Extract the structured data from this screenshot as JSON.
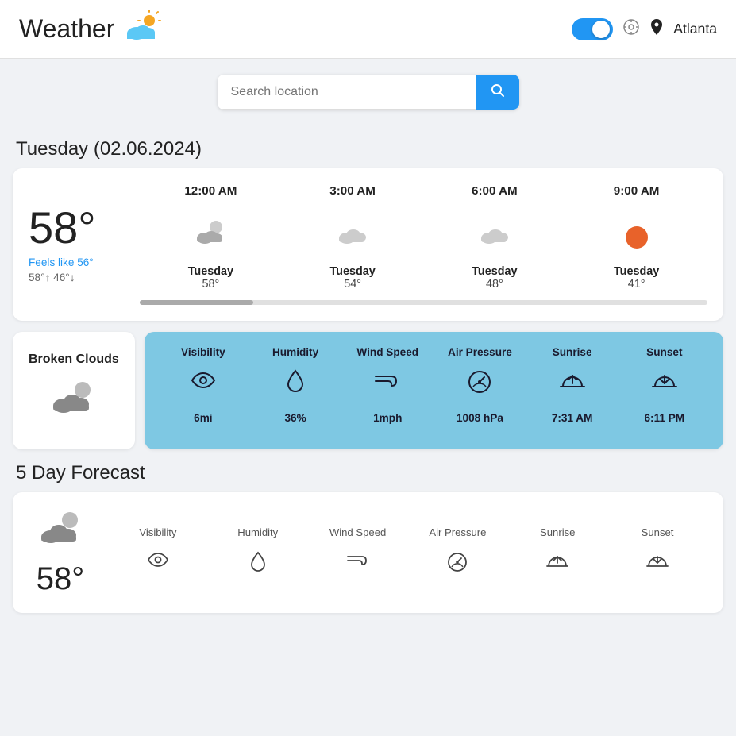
{
  "header": {
    "title": "Weather",
    "location": "Atlanta",
    "toggle_on": true
  },
  "search": {
    "placeholder": "Search location"
  },
  "current": {
    "day_label": "Tuesday (02.06.2024)",
    "temperature": "58°",
    "feels_like": "Feels like 56°",
    "temp_high": "58°",
    "temp_low": "46°",
    "condition": "Broken Clouds"
  },
  "hourly": [
    {
      "time": "12:00 AM",
      "day": "Tuesday",
      "temp": "58°",
      "icon": "partly_cloudy"
    },
    {
      "time": "3:00 AM",
      "day": "Tuesday",
      "temp": "54°",
      "icon": "cloudy"
    },
    {
      "time": "6:00 AM",
      "day": "Tuesday",
      "temp": "48°",
      "icon": "cloudy"
    },
    {
      "time": "9:00 AM",
      "day": "Tuesday",
      "temp": "41°",
      "icon": "sun"
    }
  ],
  "stats": {
    "visibility": {
      "label": "Visibility",
      "value": "6mi"
    },
    "humidity": {
      "label": "Humidity",
      "value": "36%"
    },
    "wind_speed": {
      "label": "Wind Speed",
      "value": "1mph"
    },
    "air_pressure": {
      "label": "Air Pressure",
      "value": "1008 hPa"
    },
    "sunrise": {
      "label": "Sunrise",
      "value": "7:31 AM"
    },
    "sunset": {
      "label": "Sunset",
      "value": "6:11 PM"
    }
  },
  "forecast": {
    "title": "5 Day Forecast",
    "first_day": {
      "icon": "partly_cloudy",
      "temp": "58°"
    },
    "columns": [
      "Visibility",
      "Humidity",
      "Wind Speed",
      "Air Pressure",
      "Sunrise",
      "Sunset"
    ]
  }
}
